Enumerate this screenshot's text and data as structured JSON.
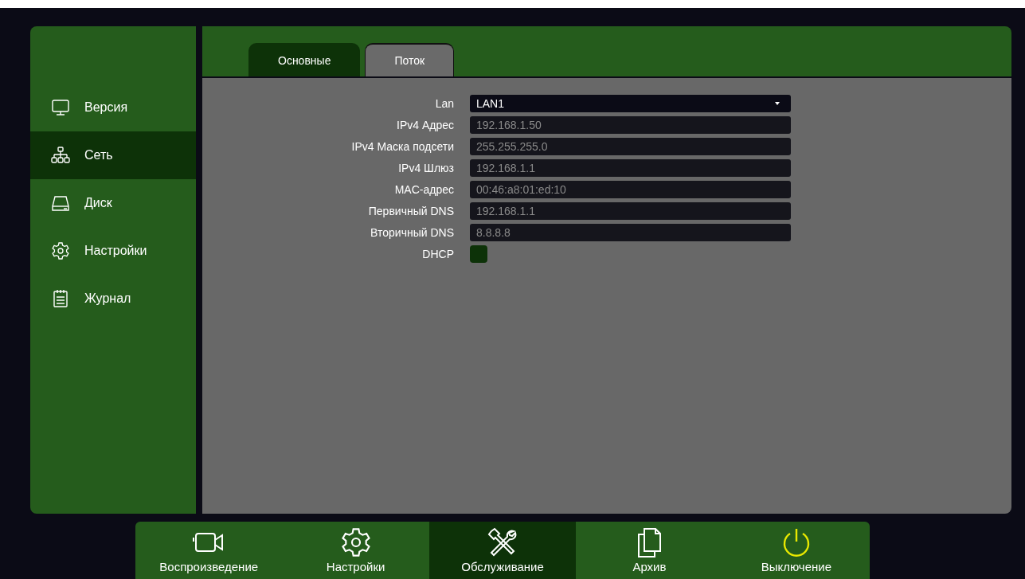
{
  "sidebar": {
    "items": [
      {
        "label": "Версия",
        "kind": "monitor",
        "selected": false
      },
      {
        "label": "Сеть",
        "kind": "network",
        "selected": true
      },
      {
        "label": "Диск",
        "kind": "disk",
        "selected": false
      },
      {
        "label": "Настройки",
        "kind": "gear",
        "selected": false
      },
      {
        "label": "Журнал",
        "kind": "notepad",
        "selected": false
      }
    ]
  },
  "tabs": [
    {
      "label": "Основные",
      "selected": true
    },
    {
      "label": "Поток",
      "selected": false
    }
  ],
  "form": {
    "rows": [
      {
        "label": "Lan",
        "kind": "dropdown",
        "value": "LAN1",
        "disabled": false
      },
      {
        "label": "IPv4 Адрес",
        "kind": "text",
        "value": "192.168.1.50",
        "disabled": true
      },
      {
        "label": "IPv4 Маска подсети",
        "kind": "text",
        "value": "255.255.255.0",
        "disabled": true
      },
      {
        "label": "IPv4 Шлюз",
        "kind": "text",
        "value": "192.168.1.1",
        "disabled": true
      },
      {
        "label": "MAC-адрес",
        "kind": "text",
        "value": "00:46:a8:01:ed:10",
        "disabled": true
      },
      {
        "label": "Первичный DNS",
        "kind": "text",
        "value": "192.168.1.1",
        "disabled": true
      },
      {
        "label": "Вторичный DNS",
        "kind": "text",
        "value": "8.8.8.8",
        "disabled": true
      },
      {
        "label": "DHCP",
        "kind": "checkbox",
        "checked": false
      }
    ]
  },
  "bottom_bar": {
    "items": [
      {
        "label": "Воспроизведение",
        "kind": "camera",
        "selected": false
      },
      {
        "label": "Настройки",
        "kind": "gear",
        "selected": false
      },
      {
        "label": "Обслуживание",
        "kind": "tools",
        "selected": true
      },
      {
        "label": "Архив",
        "kind": "files",
        "selected": false
      },
      {
        "label": "Выключение",
        "kind": "power",
        "selected": false
      }
    ]
  }
}
